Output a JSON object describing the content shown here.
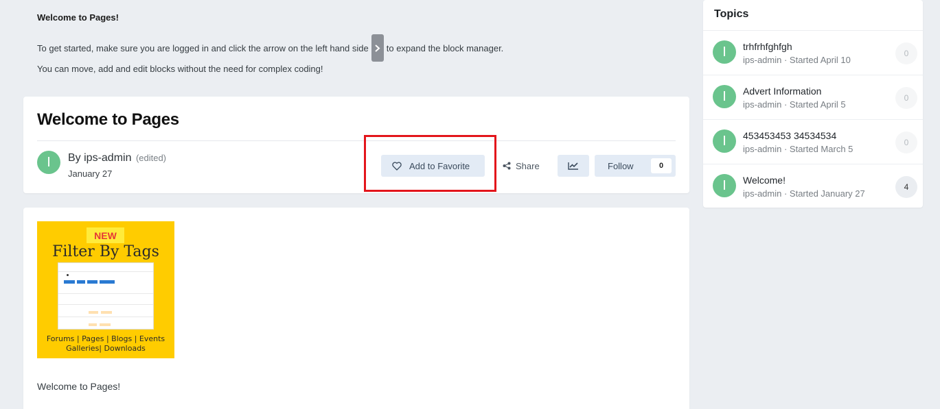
{
  "intro": {
    "title": "Welcome to Pages!",
    "line1_before": "To get started, make sure you are logged in and click the arrow on the left hand side",
    "line1_after": "to expand the block manager.",
    "line2": "You can move, add and edit blocks without the need for complex coding!"
  },
  "header": {
    "title": "Welcome to Pages",
    "author_prefix": "By",
    "author": "ips-admin",
    "edited": "(edited)",
    "date": "January 27",
    "avatar_letter": "I",
    "favorite_label": "Add to Favorite",
    "share_label": "Share",
    "follow_label": "Follow",
    "follow_count": "0"
  },
  "content": {
    "promo": {
      "badge": "NEW",
      "title": "Filter By Tags",
      "footer_line1": "Forums | Pages | Blogs | Events",
      "footer_line2": "Galleries| Downloads"
    },
    "welcome": "Welcome to Pages!"
  },
  "sidebar": {
    "title": "Topics",
    "topics": [
      {
        "title": "trhfrhfghfgh",
        "meta": "ips-admin · Started April 10",
        "count": "0"
      },
      {
        "title": "Advert Information",
        "meta": "ips-admin · Started April 5",
        "count": "0"
      },
      {
        "title": "453453453 34534534",
        "meta": "ips-admin · Started March 5",
        "count": "0"
      },
      {
        "title": "Welcome!",
        "meta": "ips-admin · Started January 27",
        "count": "4"
      }
    ]
  },
  "colors": {
    "avatar": "#6ac48d",
    "button_bg": "#e3ebf5",
    "highlight": "#e3151b",
    "promo_bg": "#ffcc00"
  }
}
